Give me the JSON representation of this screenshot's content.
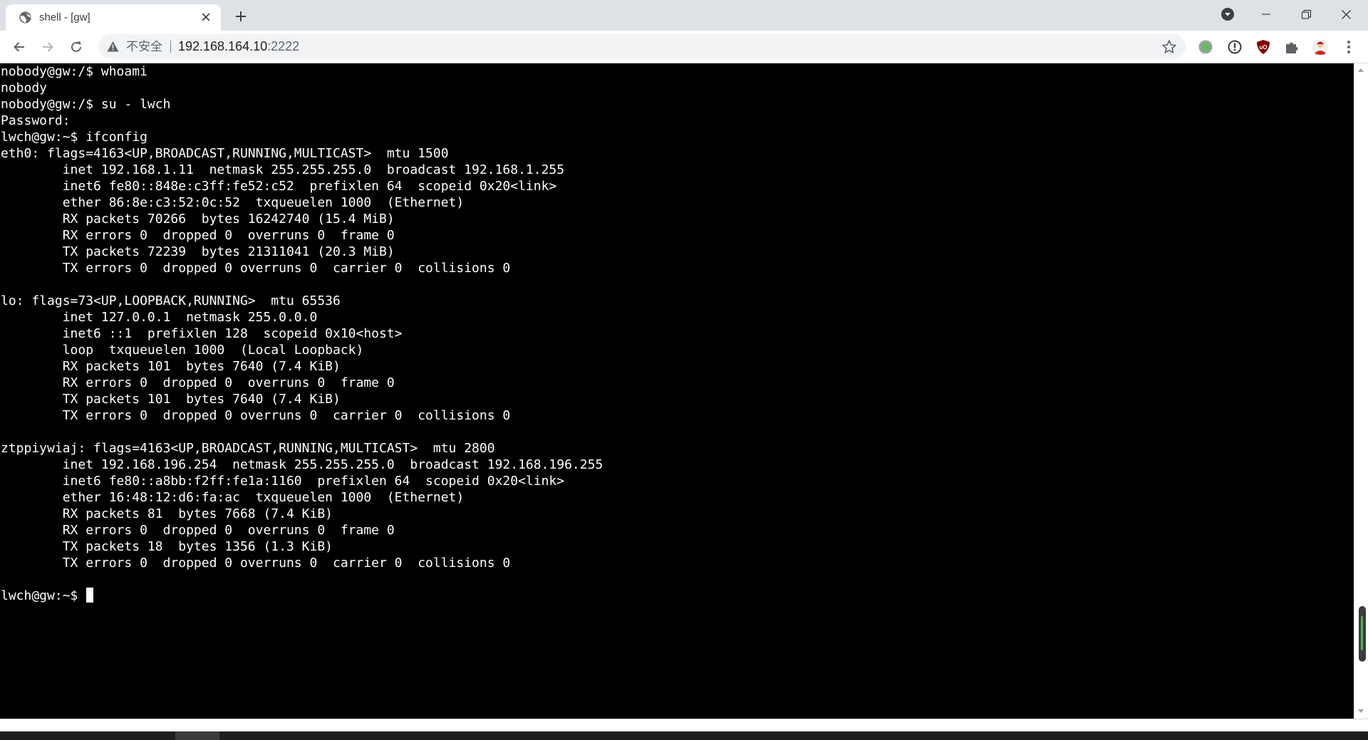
{
  "browser": {
    "tab": {
      "title": "shell - [gw]",
      "favicon": "globe-icon"
    },
    "omnibox": {
      "security_label": "不安全",
      "url_host": "192.168.164.10",
      "url_port": ":2222"
    },
    "icons": {
      "back": "arrow-left-icon",
      "forward": "arrow-right-icon",
      "reload": "reload-icon",
      "bookmark": "star-icon",
      "extensions": [
        "circle-green-icon",
        "info-circle-icon",
        "ublock-shield-icon",
        "puzzle-icon",
        "profile-avatar-icon",
        "kebab-menu-icon"
      ]
    }
  },
  "terminal": {
    "lines": [
      "nobody@gw:/$ whoami",
      "nobody",
      "nobody@gw:/$ su - lwch",
      "Password:",
      "lwch@gw:~$ ifconfig",
      "eth0: flags=4163<UP,BROADCAST,RUNNING,MULTICAST>  mtu 1500",
      "        inet 192.168.1.11  netmask 255.255.255.0  broadcast 192.168.1.255",
      "        inet6 fe80::848e:c3ff:fe52:c52  prefixlen 64  scopeid 0x20<link>",
      "        ether 86:8e:c3:52:0c:52  txqueuelen 1000  (Ethernet)",
      "        RX packets 70266  bytes 16242740 (15.4 MiB)",
      "        RX errors 0  dropped 0  overruns 0  frame 0",
      "        TX packets 72239  bytes 21311041 (20.3 MiB)",
      "        TX errors 0  dropped 0 overruns 0  carrier 0  collisions 0",
      "",
      "lo: flags=73<UP,LOOPBACK,RUNNING>  mtu 65536",
      "        inet 127.0.0.1  netmask 255.0.0.0",
      "        inet6 ::1  prefixlen 128  scopeid 0x10<host>",
      "        loop  txqueuelen 1000  (Local Loopback)",
      "        RX packets 101  bytes 7640 (7.4 KiB)",
      "        RX errors 0  dropped 0  overruns 0  frame 0",
      "        TX packets 101  bytes 7640 (7.4 KiB)",
      "        TX errors 0  dropped 0 overruns 0  carrier 0  collisions 0",
      "",
      "ztppiywiaj: flags=4163<UP,BROADCAST,RUNNING,MULTICAST>  mtu 2800",
      "        inet 192.168.196.254  netmask 255.255.255.0  broadcast 192.168.196.255",
      "        inet6 fe80::a8bb:f2ff:fe1a:1160  prefixlen 64  scopeid 0x20<link>",
      "        ether 16:48:12:d6:fa:ac  txqueuelen 1000  (Ethernet)",
      "        RX packets 81  bytes 7668 (7.4 KiB)",
      "        RX errors 0  dropped 0  overruns 0  frame 0",
      "        TX packets 18  bytes 1356 (1.3 KiB)",
      "        TX errors 0  dropped 0 overruns 0  carrier 0  collisions 0",
      ""
    ],
    "prompt": "lwch@gw:~$ "
  },
  "colors": {
    "terminal_bg": "#000000",
    "terminal_fg": "#ffffff",
    "tabstrip_bg": "#dee1e6",
    "omnibox_bg": "#f1f3f4"
  }
}
